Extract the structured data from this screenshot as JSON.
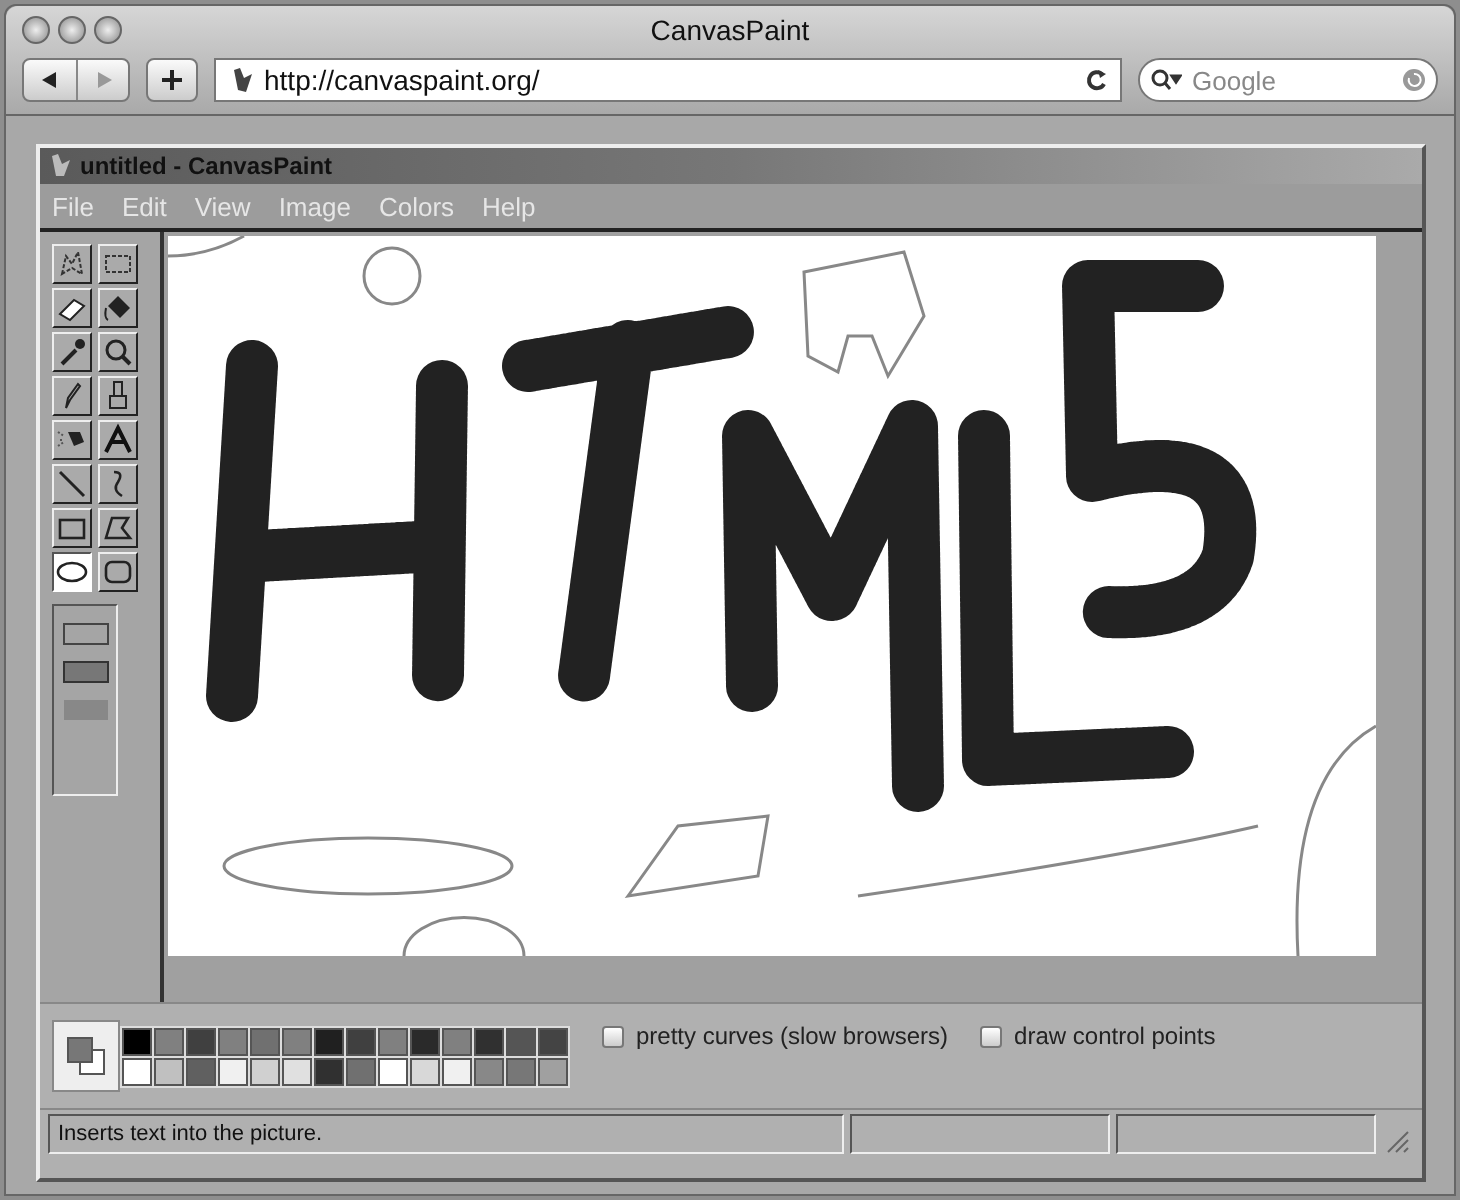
{
  "browser": {
    "title": "CanvasPaint",
    "url": "http://canvaspaint.org/",
    "search": {
      "placeholder": "Google"
    }
  },
  "app": {
    "title": "untitled - CanvasPaint",
    "menu": [
      "File",
      "Edit",
      "View",
      "Image",
      "Colors",
      "Help"
    ],
    "tools": [
      {
        "kind": "free-select",
        "selected": false
      },
      {
        "kind": "rect-select",
        "selected": false
      },
      {
        "kind": "eraser",
        "selected": false
      },
      {
        "kind": "fill",
        "selected": false
      },
      {
        "kind": "picker",
        "selected": false
      },
      {
        "kind": "zoom",
        "selected": false
      },
      {
        "kind": "pencil",
        "selected": false
      },
      {
        "kind": "brush",
        "selected": false
      },
      {
        "kind": "spray",
        "selected": false
      },
      {
        "kind": "text",
        "selected": false
      },
      {
        "kind": "line",
        "selected": false
      },
      {
        "kind": "curve",
        "selected": false
      },
      {
        "kind": "rectangle",
        "selected": false
      },
      {
        "kind": "polygon",
        "selected": false
      },
      {
        "kind": "ellipse",
        "selected": true
      },
      {
        "kind": "rounded-rect",
        "selected": false
      }
    ],
    "palette": [
      {
        "color": "#000000"
      },
      {
        "color": "#808080"
      },
      {
        "color": "#404040"
      },
      {
        "color": "#808080"
      },
      {
        "color": "#707070"
      },
      {
        "color": "#808080"
      },
      {
        "color": "#202020"
      },
      {
        "color": "#404040"
      },
      {
        "color": "#808080"
      },
      {
        "color": "#2a2a2a"
      },
      {
        "color": "#808080"
      },
      {
        "color": "#303030"
      },
      {
        "color": "#555555"
      },
      {
        "color": "#444444"
      },
      {
        "color": "#ffffff"
      },
      {
        "color": "#c0c0c0"
      },
      {
        "color": "#606060"
      },
      {
        "color": "#f0f0f0"
      },
      {
        "color": "#d0d0d0"
      },
      {
        "color": "#e0e0e0"
      },
      {
        "color": "#303030"
      },
      {
        "color": "#707070"
      },
      {
        "color": "#ffffff"
      },
      {
        "color": "#d8d8d8"
      },
      {
        "color": "#f0f0f0"
      },
      {
        "color": "#888888"
      },
      {
        "color": "#777777"
      },
      {
        "color": "#a0a0a0"
      }
    ],
    "options": [
      {
        "label": "pretty curves (slow browsers)",
        "checked": false
      },
      {
        "label": "draw control points",
        "checked": false
      }
    ],
    "status": "Inserts text into the picture."
  }
}
